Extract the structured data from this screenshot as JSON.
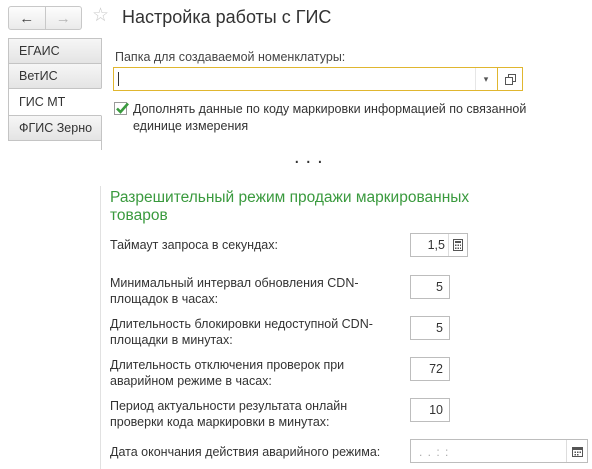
{
  "header": {
    "back_icon": "←",
    "forward_icon": "→",
    "favorite_icon": "☆",
    "title": "Настройка работы с ГИС"
  },
  "tabs": [
    {
      "label": "ЕГАИС"
    },
    {
      "label": "ВетИС"
    },
    {
      "label": "ГИС МТ"
    },
    {
      "label": "ФГИС Зерно"
    }
  ],
  "folder": {
    "label": "Папка для создаваемой номенклатуры:",
    "value": "",
    "dropdown_icon": "▾",
    "open_icon": "⧉"
  },
  "checkbox": {
    "checked": true,
    "label": "Дополнять данные по коду маркировки информацией по связанной единице измерения"
  },
  "collapsed_marker": "...",
  "permissive": {
    "title": "Разрешительный режим продажи маркированных товаров",
    "fields": [
      {
        "label": "Таймаут запроса в секундах:",
        "value": "1,5"
      },
      {
        "label": "Минимальный интервал обновления CDN-площадок в часах:",
        "value": "5"
      },
      {
        "label": "Длительность блокировки недоступной CDN-площадки в минутах:",
        "value": "5"
      },
      {
        "label": "Длительность отключения проверок при аварийном режиме в часах:",
        "value": "72"
      },
      {
        "label": "Период актуальности результата онлайн проверки кода маркировки в минутах:",
        "value": "10"
      }
    ],
    "emergency_end": {
      "label": "Дата окончания действия аварийного режима:",
      "value": ".  .        :  :"
    }
  },
  "colors": {
    "accent_green": "#3a9a3e",
    "focus_border": "#e0b62f"
  }
}
